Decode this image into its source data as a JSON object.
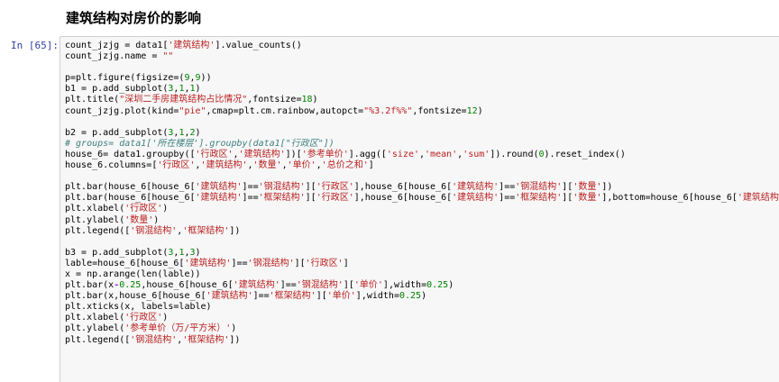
{
  "heading": "建筑结构对房价的影响",
  "cell": {
    "prompt": "In [65]:",
    "lines": [
      [
        [
          "",
          "count_jzjg = data1["
        ],
        [
          "str",
          "'建筑结构'"
        ],
        [
          "",
          "].value_counts()"
        ]
      ],
      [
        [
          "",
          "count_jzjg.name = "
        ],
        [
          "str",
          "\"\""
        ]
      ],
      [],
      [
        [
          "",
          "p=plt.figure(figsize=("
        ],
        [
          "num",
          "9"
        ],
        [
          "",
          ","
        ],
        [
          "num",
          "9"
        ],
        [
          "",
          "))"
        ]
      ],
      [
        [
          "",
          "b1 = p.add_subplot("
        ],
        [
          "num",
          "3"
        ],
        [
          "",
          ","
        ],
        [
          "num",
          "1"
        ],
        [
          "",
          ","
        ],
        [
          "num",
          "1"
        ],
        [
          "",
          ")"
        ]
      ],
      [
        [
          "",
          "plt.title("
        ],
        [
          "str",
          "\"深圳二手房建筑结构占比情况\""
        ],
        [
          "",
          ",fontsize="
        ],
        [
          "num",
          "18"
        ],
        [
          "",
          ")"
        ]
      ],
      [
        [
          "",
          "count_jzjg.plot(kind="
        ],
        [
          "str",
          "\"pie\""
        ],
        [
          "",
          ",cmap=plt.cm.rainbow,autopct="
        ],
        [
          "str",
          "\"%3.2f%%\""
        ],
        [
          "",
          ",fontsize="
        ],
        [
          "num",
          "12"
        ],
        [
          "",
          ")"
        ]
      ],
      [],
      [
        [
          "",
          "b2 = p.add_subplot("
        ],
        [
          "num",
          "3"
        ],
        [
          "",
          ","
        ],
        [
          "num",
          "1"
        ],
        [
          "",
          ","
        ],
        [
          "num",
          "2"
        ],
        [
          "",
          ")"
        ]
      ],
      [
        [
          "cm",
          "# groups= data1['所在楼层'].groupby(data1[\"行政区\"])"
        ]
      ],
      [
        [
          "",
          "house_6= data1.groupby(["
        ],
        [
          "str",
          "'行政区'"
        ],
        [
          "",
          ","
        ],
        [
          "str",
          "'建筑结构'"
        ],
        [
          "",
          "])["
        ],
        [
          "str",
          "'参考单价'"
        ],
        [
          "",
          "].agg(["
        ],
        [
          "str",
          "'size'"
        ],
        [
          "",
          ","
        ],
        [
          "str",
          "'mean'"
        ],
        [
          "",
          ","
        ],
        [
          "str",
          "'sum'"
        ],
        [
          "",
          "]).round("
        ],
        [
          "num",
          "0"
        ],
        [
          "",
          ").reset_index()"
        ]
      ],
      [
        [
          "",
          "house_6.columns=["
        ],
        [
          "str",
          "'行政区'"
        ],
        [
          "",
          ","
        ],
        [
          "str",
          "'建筑结构'"
        ],
        [
          "",
          ","
        ],
        [
          "str",
          "'数量'"
        ],
        [
          "",
          ","
        ],
        [
          "str",
          "'单价'"
        ],
        [
          "",
          ","
        ],
        [
          "str",
          "'总价之和'"
        ],
        [
          "",
          "]"
        ]
      ],
      [],
      [
        [
          "",
          "plt.bar(house_6[house_6["
        ],
        [
          "str",
          "'建筑结构'"
        ],
        [
          "",
          "]=="
        ],
        [
          "str",
          "'钢混结构'"
        ],
        [
          "",
          "]["
        ],
        [
          "str",
          "'行政区'"
        ],
        [
          "",
          "],house_6[house_6["
        ],
        [
          "str",
          "'建筑结构'"
        ],
        [
          "",
          "]=="
        ],
        [
          "str",
          "'钢混结构'"
        ],
        [
          "",
          "]["
        ],
        [
          "str",
          "'数量'"
        ],
        [
          "",
          "])"
        ]
      ],
      [
        [
          "",
          "plt.bar(house_6[house_6["
        ],
        [
          "str",
          "'建筑结构'"
        ],
        [
          "",
          "]=="
        ],
        [
          "str",
          "'框架结构'"
        ],
        [
          "",
          "]["
        ],
        [
          "str",
          "'行政区'"
        ],
        [
          "",
          "],house_6[house_6["
        ],
        [
          "str",
          "'建筑结构'"
        ],
        [
          "",
          "]=="
        ],
        [
          "str",
          "'框架结构'"
        ],
        [
          "",
          "]["
        ],
        [
          "str",
          "'数量'"
        ],
        [
          "",
          "],bottom=house_6[house_6["
        ],
        [
          "str",
          "'建筑结构'"
        ],
        [
          "",
          "]="
        ]
      ],
      [
        [
          "",
          "plt.xlabel("
        ],
        [
          "str",
          "'行政区'"
        ],
        [
          "",
          ")"
        ]
      ],
      [
        [
          "",
          "plt.ylabel("
        ],
        [
          "str",
          "'数量'"
        ],
        [
          "",
          ")"
        ]
      ],
      [
        [
          "",
          "plt.legend(["
        ],
        [
          "str",
          "'钢混结构'"
        ],
        [
          "",
          ","
        ],
        [
          "str",
          "'框架结构'"
        ],
        [
          "",
          "])"
        ]
      ],
      [],
      [
        [
          "",
          "b3 = p.add_subplot("
        ],
        [
          "num",
          "3"
        ],
        [
          "",
          ","
        ],
        [
          "num",
          "1"
        ],
        [
          "",
          ","
        ],
        [
          "num",
          "3"
        ],
        [
          "",
          ")"
        ]
      ],
      [
        [
          "",
          "lable=house_6[house_6["
        ],
        [
          "str",
          "'建筑结构'"
        ],
        [
          "",
          "]=="
        ],
        [
          "str",
          "'钢混结构'"
        ],
        [
          "",
          "]["
        ],
        [
          "str",
          "'行政区'"
        ],
        [
          "",
          "]"
        ]
      ],
      [
        [
          "",
          "x = np.arange(len(lable))"
        ]
      ],
      [
        [
          "",
          "plt.bar(x"
        ],
        [
          "op",
          "-"
        ],
        [
          "num",
          "0.25"
        ],
        [
          "",
          ",house_6[house_6["
        ],
        [
          "str",
          "'建筑结构'"
        ],
        [
          "",
          "]=="
        ],
        [
          "str",
          "'钢混结构'"
        ],
        [
          "",
          "]["
        ],
        [
          "str",
          "'单价'"
        ],
        [
          "",
          "],width="
        ],
        [
          "num",
          "0.25"
        ],
        [
          "",
          ")"
        ]
      ],
      [
        [
          "",
          "plt.bar(x,house_6[house_6["
        ],
        [
          "str",
          "'建筑结构'"
        ],
        [
          "",
          "]=="
        ],
        [
          "str",
          "'框架结构'"
        ],
        [
          "",
          "]["
        ],
        [
          "str",
          "'单价'"
        ],
        [
          "",
          "],width="
        ],
        [
          "num",
          "0.25"
        ],
        [
          "",
          ")"
        ]
      ],
      [
        [
          "",
          "plt.xticks(x, labels=lable)"
        ]
      ],
      [
        [
          "",
          "plt.xlabel("
        ],
        [
          "str",
          "'行政区'"
        ],
        [
          "",
          ")"
        ]
      ],
      [
        [
          "",
          "plt.ylabel("
        ],
        [
          "str",
          "'参考单价（万/平方米）'"
        ],
        [
          "",
          ")"
        ]
      ],
      [
        [
          "",
          "plt.legend(["
        ],
        [
          "str",
          "'钢混结构'"
        ],
        [
          "",
          ","
        ],
        [
          "str",
          "'框架结构'"
        ],
        [
          "",
          "])"
        ]
      ]
    ]
  }
}
